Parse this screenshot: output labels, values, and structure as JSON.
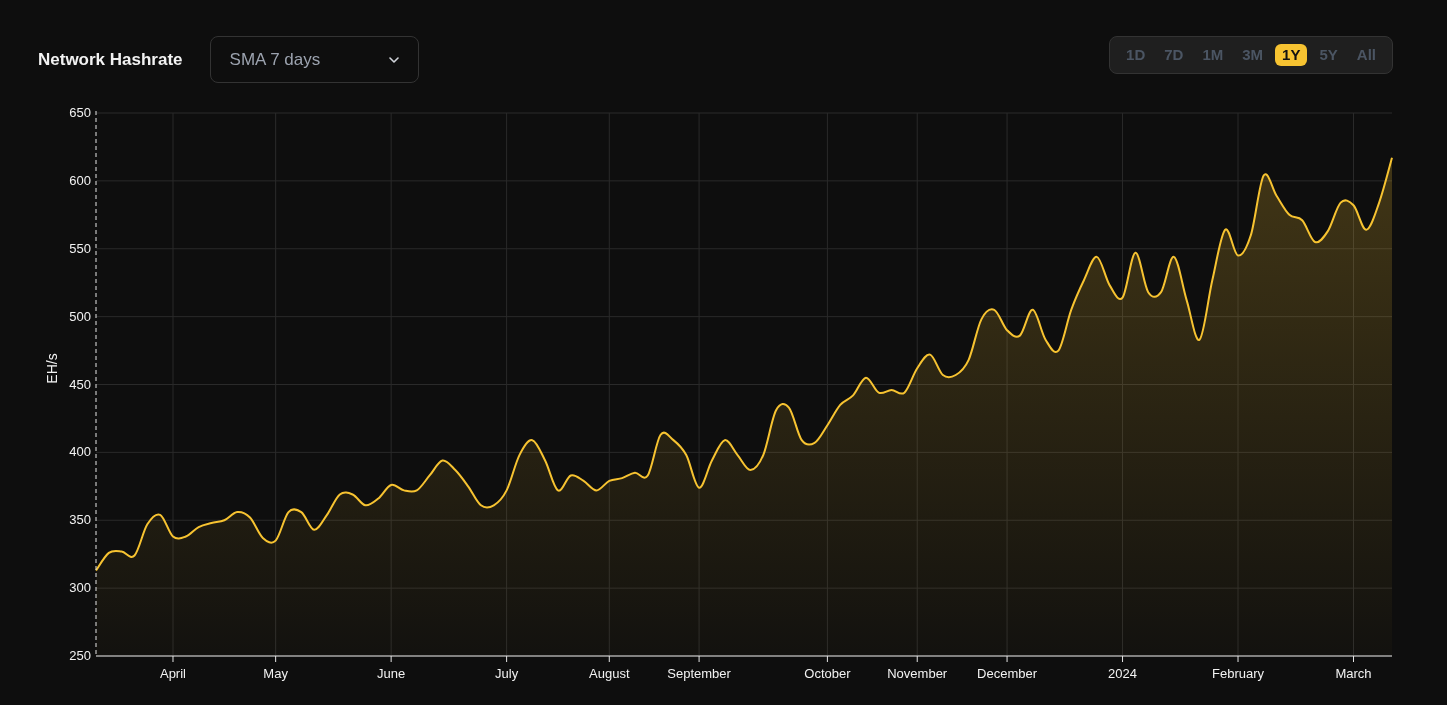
{
  "header": {
    "title": "Network Hashrate",
    "dropdown": {
      "value": "SMA 7 days"
    }
  },
  "ranges": [
    {
      "label": "1D",
      "selected": false
    },
    {
      "label": "7D",
      "selected": false
    },
    {
      "label": "1M",
      "selected": false
    },
    {
      "label": "3M",
      "selected": false
    },
    {
      "label": "1Y",
      "selected": true
    },
    {
      "label": "5Y",
      "selected": false
    },
    {
      "label": "All",
      "selected": false
    }
  ],
  "chart_data": {
    "type": "area",
    "grid": true,
    "ylabel": "EH/s",
    "ylim": [
      250,
      650
    ],
    "yticks": [
      250,
      300,
      350,
      400,
      450,
      500,
      550,
      600,
      650
    ],
    "categories": [
      null,
      null,
      null,
      null,
      null,
      null,
      "April",
      null,
      null,
      null,
      null,
      null,
      null,
      null,
      "May",
      null,
      null,
      null,
      null,
      null,
      null,
      null,
      null,
      "June",
      null,
      null,
      null,
      null,
      null,
      null,
      null,
      null,
      "July",
      null,
      null,
      null,
      null,
      null,
      null,
      null,
      "August",
      null,
      null,
      null,
      null,
      null,
      null,
      "September",
      null,
      null,
      null,
      null,
      null,
      null,
      null,
      null,
      null,
      "October",
      null,
      null,
      null,
      null,
      null,
      null,
      "November",
      null,
      null,
      null,
      null,
      null,
      null,
      "December",
      null,
      null,
      null,
      null,
      null,
      null,
      null,
      null,
      "2024",
      null,
      null,
      null,
      null,
      null,
      null,
      null,
      null,
      "February",
      null,
      null,
      null,
      null,
      null,
      null,
      null,
      null,
      "March",
      null,
      null,
      null
    ],
    "series": [
      {
        "color": "#f7c331",
        "values": [
          313,
          326,
          327,
          324,
          347,
          354,
          338,
          338,
          345,
          348,
          350,
          356,
          352,
          337,
          335,
          356,
          356,
          343,
          354,
          369,
          369,
          361,
          366,
          376,
          372,
          372,
          383,
          394,
          387,
          375,
          361,
          361,
          372,
          398,
          409,
          394,
          372,
          383,
          379,
          372,
          379,
          381,
          385,
          383,
          413,
          409,
          398,
          374,
          394,
          409,
          398,
          387,
          398,
          431,
          433,
          409,
          407,
          420,
          435,
          442,
          455,
          444,
          446,
          444,
          462,
          472,
          457,
          457,
          468,
          498,
          505,
          490,
          486,
          505,
          483,
          475,
          505,
          527,
          544,
          523,
          514,
          547,
          518,
          518,
          544,
          512,
          483,
          527,
          564,
          545,
          560,
          604,
          589,
          575,
          571,
          555,
          563,
          584,
          582,
          564,
          584,
          617
        ]
      }
    ]
  }
}
